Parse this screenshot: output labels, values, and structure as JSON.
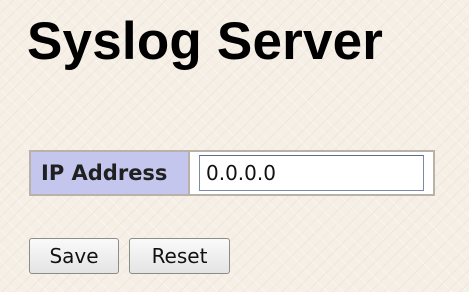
{
  "page": {
    "title": "Syslog Server"
  },
  "form": {
    "ip_label": "IP Address",
    "ip_value": "0.0.0.0"
  },
  "buttons": {
    "save_label": "Save",
    "reset_label": "Reset"
  }
}
